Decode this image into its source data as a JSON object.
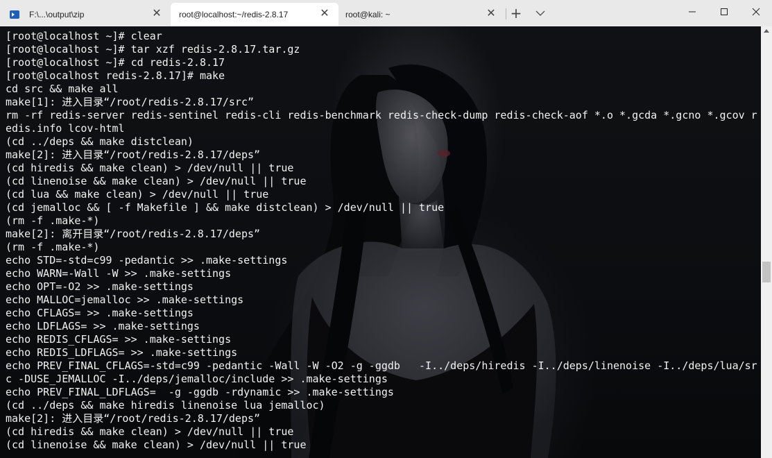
{
  "window": {
    "tabs": [
      {
        "label": "F:\\...\\output\\zip",
        "active": false
      },
      {
        "label": "root@localhost:~/redis-2.8.17",
        "active": true
      },
      {
        "label": "root@kali: ~",
        "active": false
      }
    ],
    "icons": {
      "new_tab": "plus-icon",
      "dropdown": "chevron-down-icon",
      "minimize": "minimize-icon",
      "maximize": "maximize-icon",
      "close": "close-icon"
    },
    "accent": "#1f5fb8"
  },
  "terminal": {
    "lines": [
      "[root@localhost ~]# clear",
      "[root@localhost ~]# tar xzf redis-2.8.17.tar.gz",
      "[root@localhost ~]# cd redis-2.8.17",
      "[root@localhost redis-2.8.17]# make",
      "cd src && make all",
      "make[1]: 进入目录“/root/redis-2.8.17/src”",
      "rm -rf redis-server redis-sentinel redis-cli redis-benchmark redis-check-dump redis-check-aof *.o *.gcda *.gcno *.gcov r",
      "edis.info lcov-html",
      "(cd ../deps && make distclean)",
      "make[2]: 进入目录“/root/redis-2.8.17/deps”",
      "(cd hiredis && make clean) > /dev/null || true",
      "(cd linenoise && make clean) > /dev/null || true",
      "(cd lua && make clean) > /dev/null || true",
      "(cd jemalloc && [ -f Makefile ] && make distclean) > /dev/null || true",
      "(rm -f .make-*)",
      "make[2]: 离开目录“/root/redis-2.8.17/deps”",
      "(rm -f .make-*)",
      "echo STD=-std=c99 -pedantic >> .make-settings",
      "echo WARN=-Wall -W >> .make-settings",
      "echo OPT=-O2 >> .make-settings",
      "echo MALLOC=jemalloc >> .make-settings",
      "echo CFLAGS= >> .make-settings",
      "echo LDFLAGS= >> .make-settings",
      "echo REDIS_CFLAGS= >> .make-settings",
      "echo REDIS_LDFLAGS= >> .make-settings",
      "echo PREV_FINAL_CFLAGS=-std=c99 -pedantic -Wall -W -O2 -g -ggdb   -I../deps/hiredis -I../deps/linenoise -I../deps/lua/sr",
      "c -DUSE_JEMALLOC -I../deps/jemalloc/include >> .make-settings",
      "echo PREV_FINAL_LDFLAGS=  -g -ggdb -rdynamic >> .make-settings",
      "(cd ../deps && make hiredis linenoise lua jemalloc)",
      "make[2]: 进入目录“/root/redis-2.8.17/deps”",
      "(cd hiredis && make clean) > /dev/null || true",
      "(cd linenoise && make clean) > /dev/null || true"
    ],
    "text_color": "#f2f2f2"
  }
}
